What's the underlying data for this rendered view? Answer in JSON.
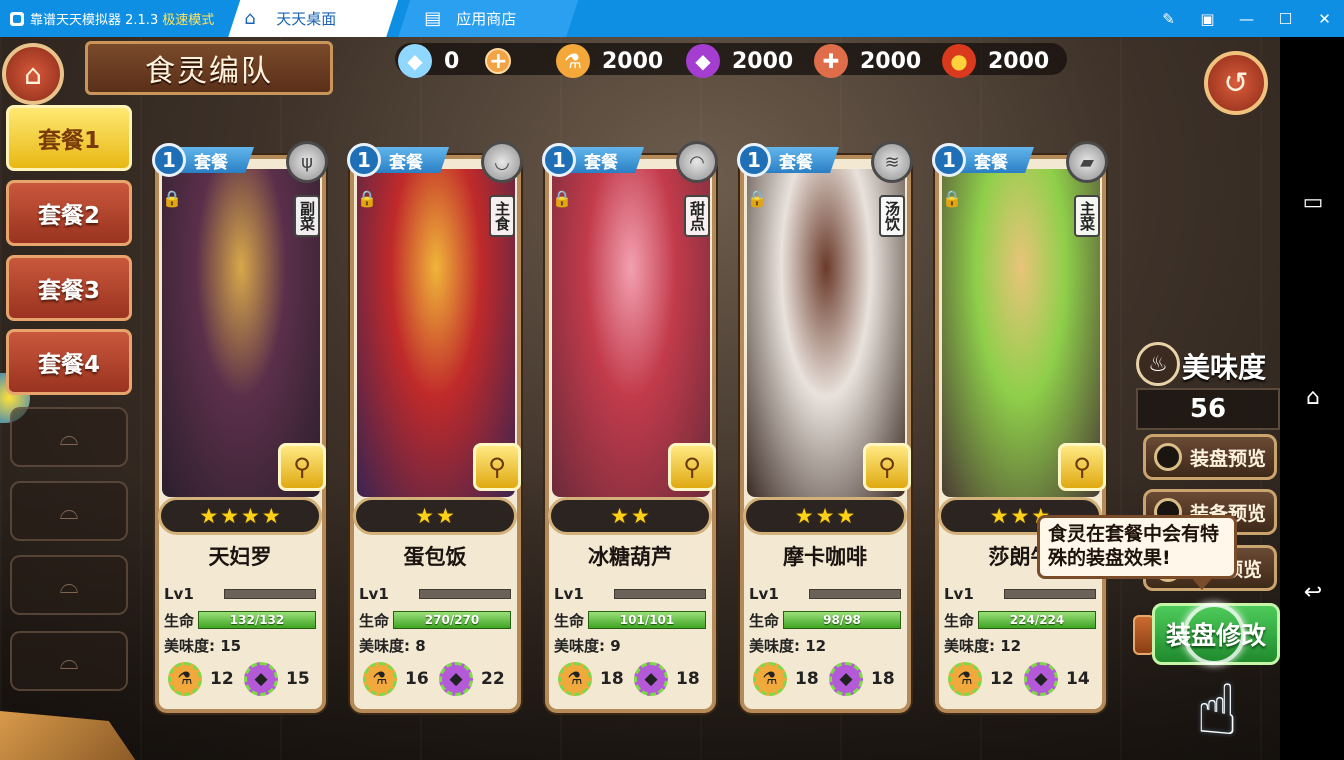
{
  "emulator": {
    "title": "靠谱天天模拟器 2.1.3",
    "mode": "极速模式",
    "tabs": [
      {
        "label": "天天桌面",
        "icon": "home-icon"
      },
      {
        "label": "应用商店",
        "icon": "store-icon"
      }
    ],
    "window_controls": [
      "pin-icon",
      "restore-icon",
      "minimize-icon",
      "maximize-icon",
      "close-icon"
    ]
  },
  "game": {
    "title": "食灵编队",
    "resources": [
      {
        "icon": "diamond-icon",
        "value": "0"
      },
      {
        "icon": "potion-icon",
        "value": "2000"
      },
      {
        "icon": "crystal-icon",
        "value": "2000"
      },
      {
        "icon": "meat-icon",
        "value": "2000"
      },
      {
        "icon": "bomb-icon",
        "value": "2000"
      }
    ],
    "side_tabs": [
      "套餐1",
      "套餐2",
      "套餐3",
      "套餐4"
    ],
    "set_label": "套餐",
    "cards": [
      {
        "set": "1",
        "type": "副菜",
        "stars": 4,
        "name": "天妇罗",
        "lv": "Lv1",
        "hp_label": "生命",
        "hp": "132/132",
        "taste_label": "美味度:",
        "taste": "15",
        "stat1": "12",
        "stat2": "15"
      },
      {
        "set": "1",
        "type": "主食",
        "stars": 2,
        "name": "蛋包饭",
        "lv": "Lv1",
        "hp_label": "生命",
        "hp": "270/270",
        "taste_label": "美味度:",
        "taste": "8",
        "stat1": "16",
        "stat2": "22"
      },
      {
        "set": "1",
        "type": "甜点",
        "stars": 2,
        "name": "冰糖葫芦",
        "lv": "Lv1",
        "hp_label": "生命",
        "hp": "101/101",
        "taste_label": "美味度:",
        "taste": "9",
        "stat1": "18",
        "stat2": "18"
      },
      {
        "set": "1",
        "type": "汤饮",
        "stars": 3,
        "name": "摩卡咖啡",
        "lv": "Lv1",
        "hp_label": "生命",
        "hp": "98/98",
        "taste_label": "美味度:",
        "taste": "12",
        "stat1": "18",
        "stat2": "18"
      },
      {
        "set": "1",
        "type": "主菜",
        "stars": 3,
        "name": "莎朗牛",
        "lv": "Lv1",
        "hp_label": "生命",
        "hp": "224/224",
        "taste_label": "美味度:",
        "taste": "12",
        "stat1": "12",
        "stat2": "14"
      }
    ],
    "taste_panel": {
      "title": "美味度",
      "value": "56"
    },
    "preview_buttons": [
      "装盘预览",
      "装备预览",
      "预览"
    ],
    "modify_button": "装盘修改",
    "tooltip": "食灵在套餐中会有特殊的装盘效果!",
    "colors": {
      "accent_blue": "#0f8fe4",
      "gold": "#ffd21a",
      "hp_green": "#3fa423"
    }
  }
}
